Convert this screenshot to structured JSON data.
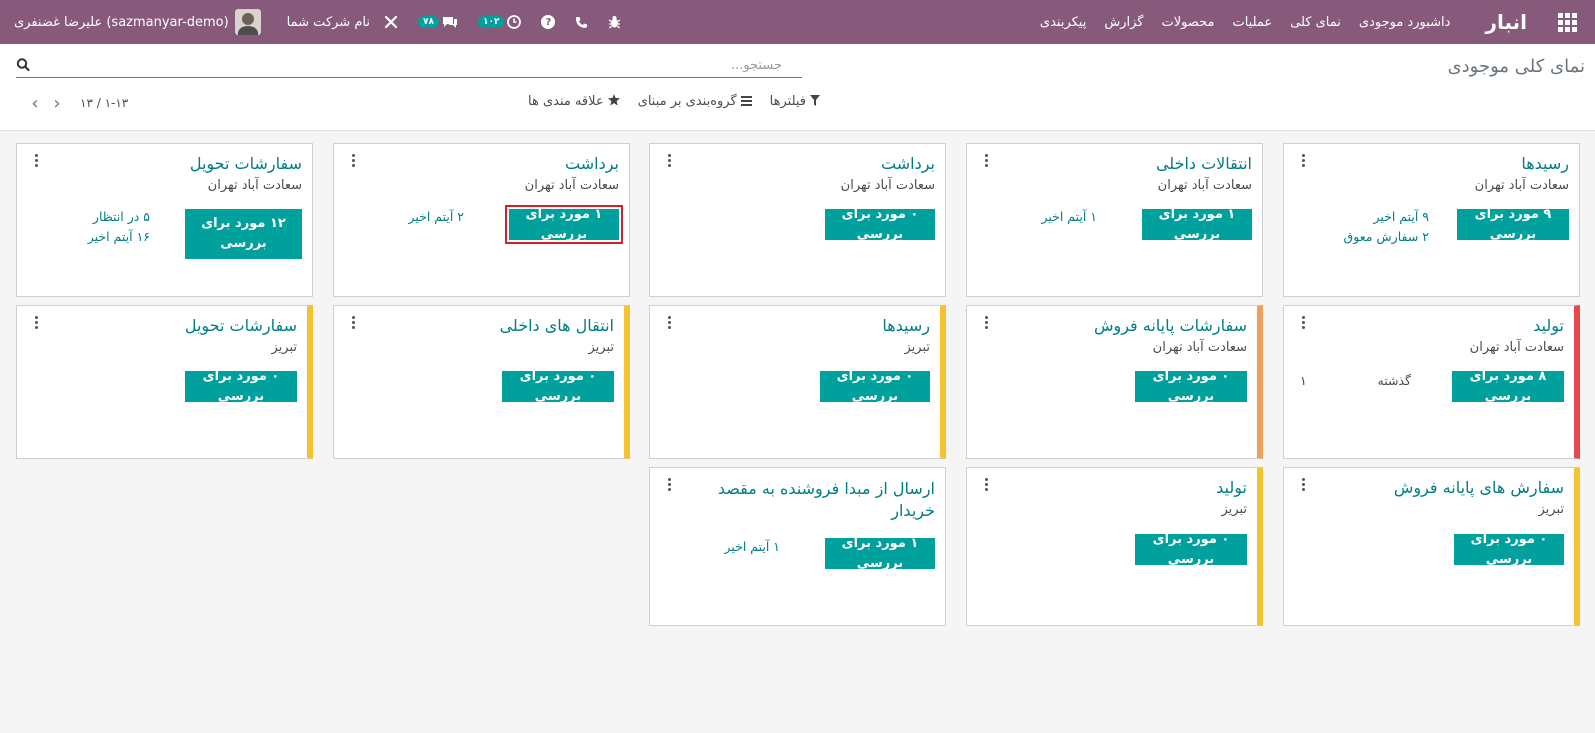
{
  "navbar": {
    "brand": "انبار",
    "menu": [
      "داشبورد موجودی",
      "نمای کلی",
      "عملیات",
      "محصولات",
      "گزارش",
      "پیکربندی"
    ],
    "user_name": "علیرضا غضنفری (sazmanyar-demo)",
    "company": "نام شرکت شما",
    "messages_count": "۷۸",
    "activities_count": "۱۰۲",
    "icons": [
      "apps-icon",
      "bug-icon",
      "phone-icon",
      "help-icon",
      "clock-icon",
      "chat-icon",
      "tools-icon",
      "avatar"
    ]
  },
  "control": {
    "title": "نمای کلی موجودی",
    "search_placeholder": "جستجو...",
    "filters": "فیلترها",
    "group_by": "گروه‌بندی بر مبنای",
    "favorites": "علاقه مندی ها",
    "pager": "۱-۱۳ / ۱۳"
  },
  "cards": [
    {
      "title": "رسیدها",
      "subtitle": "سعادت آباد تهران",
      "button": "۹ مورد برای بررسی",
      "stats": [
        "۹ آیتم اخیر",
        "۲ سفارش معوق"
      ],
      "bar": "none"
    },
    {
      "title": "انتقالات داخلی",
      "subtitle": "سعادت آباد تهران",
      "button": "۱ مورد برای بررسی",
      "stats": [
        "۱ آیتم اخیر"
      ],
      "bar": "none"
    },
    {
      "title": "برداشت",
      "subtitle": "سعادت آباد تهران",
      "button": "۰ مورد برای بررسی",
      "stats": [],
      "bar": "none"
    },
    {
      "title": "برداشت",
      "subtitle": "سعادت آباد تهران",
      "button": "۱ مورد برای بررسی",
      "stats": [
        "۲ آیتم اخیر"
      ],
      "bar": "none",
      "highlighted": true
    },
    {
      "title": "سفارشات تحویل",
      "subtitle": "سعادت آباد تهران",
      "button": "۱۲ مورد برای بررسی",
      "stats": [
        "۵ در انتظار",
        "۱۶ آیتم اخیر"
      ],
      "bar": "none"
    },
    {
      "title": "تولید",
      "subtitle": "سعادت آباد تهران",
      "button": "۸ مورد برای بررسی",
      "stats": [
        "گذشته",
        "۱"
      ],
      "bar": "#e8484b"
    },
    {
      "title": "سفارشات پایانه فروش",
      "subtitle": "سعادت آباد تهران",
      "button": "۰ مورد برای بررسی",
      "stats": [],
      "bar": "#f0a05c"
    },
    {
      "title": "رسیدها",
      "subtitle": "تبریز",
      "button": "۰ مورد برای بررسی",
      "stats": [],
      "bar": "#f4c430"
    },
    {
      "title": "انتقال های داخلی",
      "subtitle": "تبریز",
      "button": "۰ مورد برای بررسی",
      "stats": [],
      "bar": "#f4c430"
    },
    {
      "title": "سفارشات تحویل",
      "subtitle": "تبریز",
      "button": "۰ مورد برای بررسی",
      "stats": [],
      "bar": "#f4c430"
    },
    {
      "title": "سفارش های پایانه فروش",
      "subtitle": "تبریز",
      "button": "۰ مورد برای بررسی",
      "stats": [],
      "bar": "#f4c430"
    },
    {
      "title": "تولید",
      "subtitle": "تبریز",
      "button": "۰ مورد برای بررسی",
      "stats": [],
      "bar": "#f4c430"
    },
    {
      "title": "ارسال از مبدا فروشنده به مقصد خریدار",
      "subtitle": "",
      "button": "۱ مورد برای بررسی",
      "stats": [
        "۱ آیتم اخیر"
      ],
      "bar": "none"
    }
  ],
  "colors": {
    "navbar": "#875a7b",
    "accent": "#00a09d",
    "title_teal": "#017e84",
    "highlight_red": "#d72027"
  }
}
